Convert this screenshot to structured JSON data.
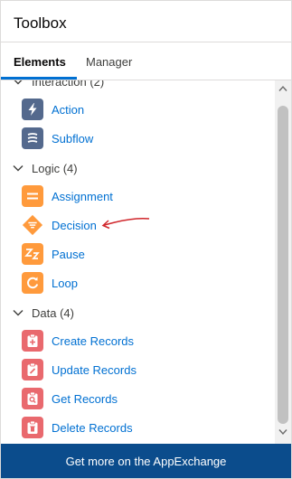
{
  "header": {
    "title": "Toolbox"
  },
  "tabs": [
    {
      "label": "Elements",
      "active": true
    },
    {
      "label": "Manager",
      "active": false
    }
  ],
  "sections": [
    {
      "label": "Interaction (2)",
      "items": [
        {
          "label": "Action",
          "icon": "lightning-bolt-icon",
          "color": "#54698d"
        },
        {
          "label": "Subflow",
          "icon": "subflow-icon",
          "color": "#54698d"
        }
      ]
    },
    {
      "label": "Logic (4)",
      "items": [
        {
          "label": "Assignment",
          "icon": "assignment-equals-icon",
          "color": "#ff9a3c"
        },
        {
          "label": "Decision",
          "icon": "decision-diamond-icon",
          "color": "#ff9a3c"
        },
        {
          "label": "Pause",
          "icon": "pause-zz-icon",
          "color": "#ff9a3c"
        },
        {
          "label": "Loop",
          "icon": "loop-arrow-icon",
          "color": "#ff9a3c"
        }
      ]
    },
    {
      "label": "Data (4)",
      "items": [
        {
          "label": "Create Records",
          "icon": "create-records-icon",
          "color": "#e9696e"
        },
        {
          "label": "Update Records",
          "icon": "update-records-icon",
          "color": "#e9696e"
        },
        {
          "label": "Get Records",
          "icon": "get-records-icon",
          "color": "#e9696e"
        },
        {
          "label": "Delete Records",
          "icon": "delete-records-icon",
          "color": "#e9696e"
        }
      ]
    }
  ],
  "footer": {
    "label": "Get more on the AppExchange"
  },
  "colors": {
    "link": "#0070d2",
    "footer_bg": "#0b4c8c",
    "accent": "#0070d2"
  }
}
